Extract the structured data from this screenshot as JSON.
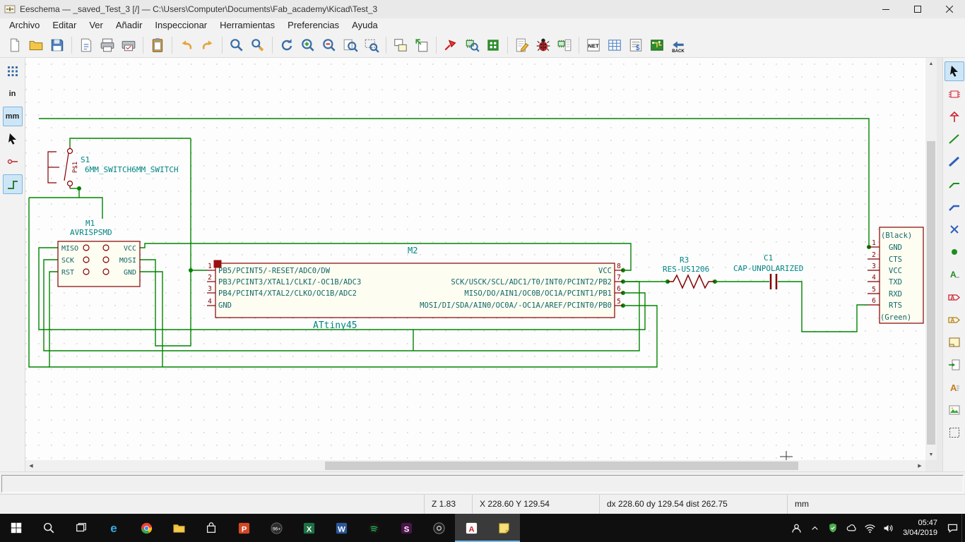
{
  "window": {
    "title": "Eeschema — _saved_Test_3 [/] — C:\\Users\\Computer\\Documents\\Fab_academy\\Kicad\\Test_3",
    "buttons": [
      "minimize",
      "maximize",
      "close"
    ]
  },
  "menu": {
    "items": [
      "Archivo",
      "Editar",
      "Ver",
      "Añadir",
      "Inspeccionar",
      "Herramientas",
      "Preferencias",
      "Ayuda"
    ]
  },
  "colors": {
    "wire_green": "#008400",
    "symbol_maroon": "#840000",
    "field_teal": "#008484",
    "pressed_blue": "#cde6f7"
  },
  "toolbar_top": {
    "netlist_label": "NET",
    "bom_label": "$",
    "back_label": "BACK",
    "buttons": [
      "new-schematic",
      "open-schematic",
      "save",
      "page-settings",
      "print",
      "plot",
      "paste",
      "undo",
      "redo",
      "find",
      "find-replace",
      "redraw",
      "zoom-in",
      "zoom-out",
      "zoom-fit",
      "zoom-selection",
      "hierarchy-navigator",
      "leave-sheet",
      "symbol-editor",
      "symbol-browser",
      "footprint-editor",
      "annotate",
      "erc-check",
      "assign-footprints",
      "generate-netlist",
      "edit-symbol-fields",
      "generate-bom",
      "run-pcbnew",
      "back-annotate"
    ]
  },
  "toolbar_left": {
    "inches_label": "in",
    "mm_label": "mm",
    "buttons": [
      "grid-toggle",
      "units-inches",
      "units-mm",
      "cursor-shape",
      "hidden-pins",
      "hv-wires"
    ]
  },
  "toolbar_right": {
    "label_letter": "A",
    "buttons": [
      "select",
      "place-symbol",
      "place-power",
      "place-wire",
      "place-bus",
      "wire-to-bus-entry",
      "bus-to-bus-entry",
      "no-connect",
      "junction",
      "net-label",
      "global-label",
      "hierarchical-label",
      "hierarchical-sheet",
      "import-sheet-pin",
      "text",
      "image",
      "delete"
    ]
  },
  "schematic": {
    "s1": {
      "pin": "P$1",
      "ref": "S1",
      "value": "6MM_SWITCH6MM_SWITCH"
    },
    "m1": {
      "ref": "M1",
      "value": "AVRISPSMD",
      "left_pins": [
        "MISO",
        "SCK",
        "RST"
      ],
      "right_pins": [
        "VCC",
        "MOSI",
        "GND"
      ]
    },
    "m2": {
      "ref": "M2",
      "value": "ATtiny45",
      "left_numbers": [
        "1",
        "2",
        "3",
        "4"
      ],
      "right_numbers": [
        "8",
        "7",
        "6",
        "5"
      ],
      "left_pins": [
        "PB5/PCINT5/-RESET/ADC0/DW",
        "PB3/PCINT3/XTAL1/CLKI/-OC1B/ADC3",
        "PB4/PCINT4/XTAL2/CLKO/OC1B/ADC2",
        "GND"
      ],
      "right_pins": [
        "VCC",
        "SCK/USCK/SCL/ADC1/T0/INT0/PCINT2/PB2",
        "MISO/DO/AIN1/OC0B/OC1A/PCINT1/PB1",
        "MOSI/DI/SDA/AIN0/OC0A/-OC1A/AREF/PCINT0/PB0"
      ]
    },
    "r3": {
      "ref": "R3",
      "value": "RES-US1206"
    },
    "c1": {
      "ref": "C1",
      "value": "CAP-UNPOLARIZED"
    },
    "j1": {
      "labels": [
        "(Black)",
        "GND",
        "CTS",
        "VCC",
        "TXD",
        "RXD",
        "RTS",
        "(Green)"
      ],
      "numbers": [
        "1",
        "2",
        "3",
        "4",
        "5",
        "6"
      ]
    }
  },
  "statusbar": {
    "zoom": "Z 1.83",
    "position": "X 228.60 Y 129.54",
    "delta": "dx 228.60 dy 129.54 dist 262.75",
    "units": "mm"
  },
  "taskbar": {
    "badge": "96+",
    "time": "05:47",
    "date": "3/04/2019",
    "letters": {
      "edge": "e",
      "powerpoint": "P",
      "excel": "X",
      "word": "W",
      "slack": "S",
      "acrobat": "A"
    },
    "apps": [
      "start",
      "search",
      "task-view",
      "edge",
      "chrome",
      "file-explorer",
      "store",
      "powerpoint",
      "messages",
      "excel",
      "word",
      "spotify",
      "slack",
      "recorder",
      "acrobat",
      "notes"
    ],
    "tray": [
      "user",
      "chevron-up",
      "shield",
      "cloud",
      "wifi",
      "volume",
      "clock",
      "action-center"
    ]
  }
}
